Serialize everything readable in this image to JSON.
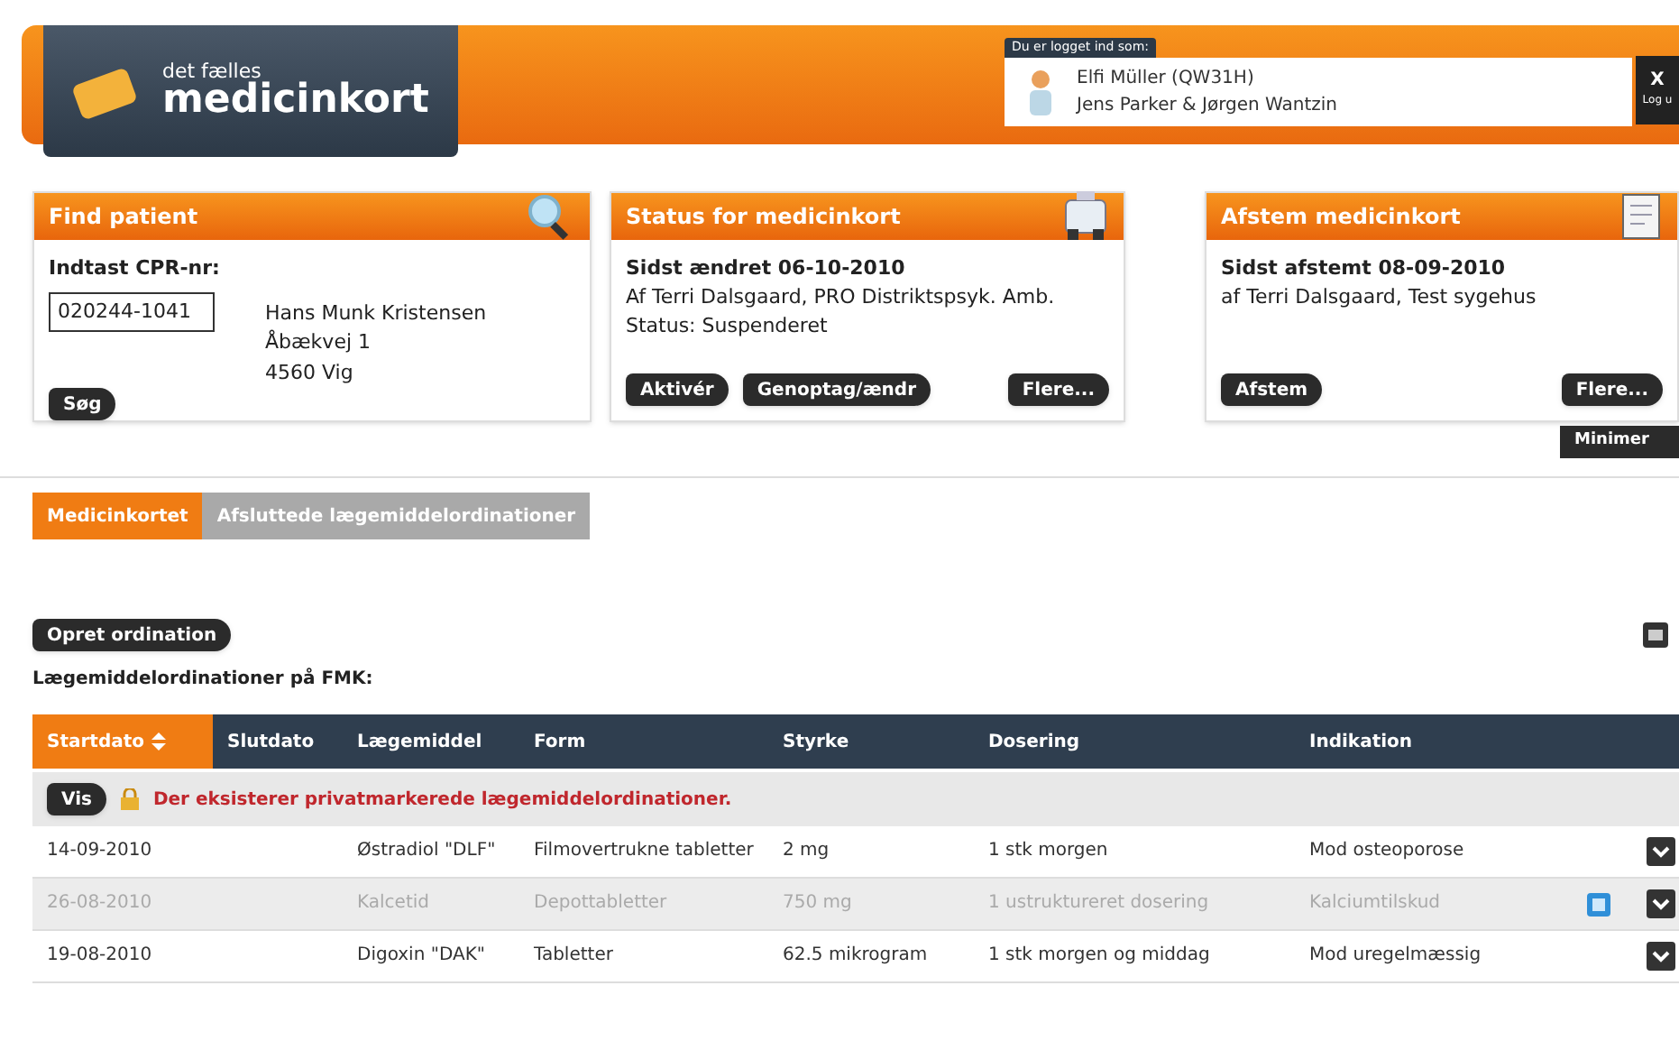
{
  "header": {
    "brand_small": "det fælles",
    "brand": "medicinkort",
    "login_label": "Du er logget ind som:",
    "user": "Elfi Müller (QW31H)",
    "team": "Jens Parker & Jørgen Wantzin",
    "logout_x": "X",
    "logout": "Log u"
  },
  "cards": [
    {
      "kind": "find",
      "title": "Find patient",
      "cpr_label": "Indtast CPR-nr:",
      "cpr_value": "020244-1041",
      "patient": [
        "Hans Munk Kristensen",
        "Åbækvej 1",
        "4560 Vig"
      ],
      "buttons": [
        "Søg"
      ]
    },
    {
      "kind": "status",
      "title": "Status for medicinkort",
      "lines": [
        "Sidst ændret 06-10-2010",
        "Af Terri Dalsgaard, PRO Distriktspsyk. Amb.",
        "Status: Suspenderet"
      ],
      "buttons": [
        "Aktivér",
        "Genoptag/ændr"
      ],
      "more": "Flere..."
    },
    {
      "kind": "reconcile",
      "title": "Afstem medicinkort",
      "lines": [
        "Sidst afstemt 08-09-2010",
        "af Terri Dalsgaard, Test sygehus"
      ],
      "buttons": [
        "Afstem"
      ],
      "more": "Flere..."
    }
  ],
  "minimize": "Minimer",
  "tabs": [
    {
      "label": "Medicinkortet",
      "selected": true
    },
    {
      "label": "Afsluttede lægemiddelordinationer",
      "selected": false
    }
  ],
  "create_button": "Opret ordination",
  "list_title": "Lægemiddelordinationer på FMK:",
  "table": {
    "columns": [
      {
        "label": "Startdato",
        "sorted": true
      },
      {
        "label": "Slutdato",
        "sorted": false
      },
      {
        "label": "Lægemiddel",
        "sorted": false
      },
      {
        "label": "Form",
        "sorted": false
      },
      {
        "label": "Styrke",
        "sorted": false
      },
      {
        "label": "Dosering",
        "sorted": false
      },
      {
        "label": "Indikation",
        "sorted": false
      }
    ],
    "notice_button": "Vis",
    "notice": "Der eksisterer privatmarkerede lægemiddelordinationer.",
    "rows": [
      {
        "disabled": false,
        "note": false,
        "cells": [
          "14-09-2010",
          "",
          "Østradiol \"DLF\"",
          "Filmovertrukne tabletter",
          "2 mg",
          "1 stk morgen",
          "Mod osteoporose"
        ]
      },
      {
        "disabled": true,
        "note": true,
        "cells": [
          "26-08-2010",
          "",
          "Kalcetid",
          "Depottabletter",
          "750 mg",
          "1 ustruktureret dosering",
          "Kalciumtilskud"
        ]
      },
      {
        "disabled": false,
        "note": false,
        "cells": [
          "19-08-2010",
          "",
          "Digoxin \"DAK\"",
          "Tabletter",
          "62.5 mikrogram",
          "1 stk morgen og middag",
          "Mod uregelmæssig"
        ]
      }
    ]
  }
}
